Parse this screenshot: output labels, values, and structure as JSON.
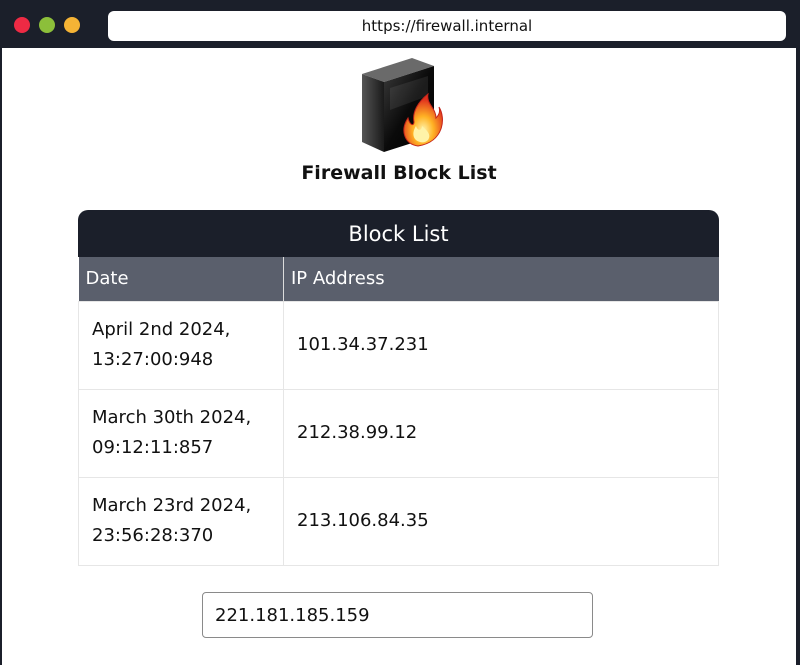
{
  "browser": {
    "url": "https://firewall.internal"
  },
  "app": {
    "title": "Firewall Block List",
    "logo_icon": "firewall-server-flame-icon"
  },
  "block_list": {
    "header": "Block List",
    "columns": [
      "Date",
      "IP Address"
    ],
    "rows": [
      {
        "date_line1": "April 2nd 2024,",
        "date_line2": "13:27:00:948",
        "ip": "101.34.37.231"
      },
      {
        "date_line1": "March 30th 2024,",
        "date_line2": "09:12:11:857",
        "ip": "212.38.99.12"
      },
      {
        "date_line1": "March 23rd 2024,",
        "date_line2": "23:56:28:370",
        "ip": "213.106.84.35"
      }
    ]
  },
  "ip_input": {
    "value": "221.181.185.159"
  },
  "colors": {
    "frame": "#1b1f2a",
    "table_header": "#5a5f6c",
    "close": "#ee2a44",
    "minimize": "#8cbf3a",
    "maximize": "#f5b335"
  }
}
